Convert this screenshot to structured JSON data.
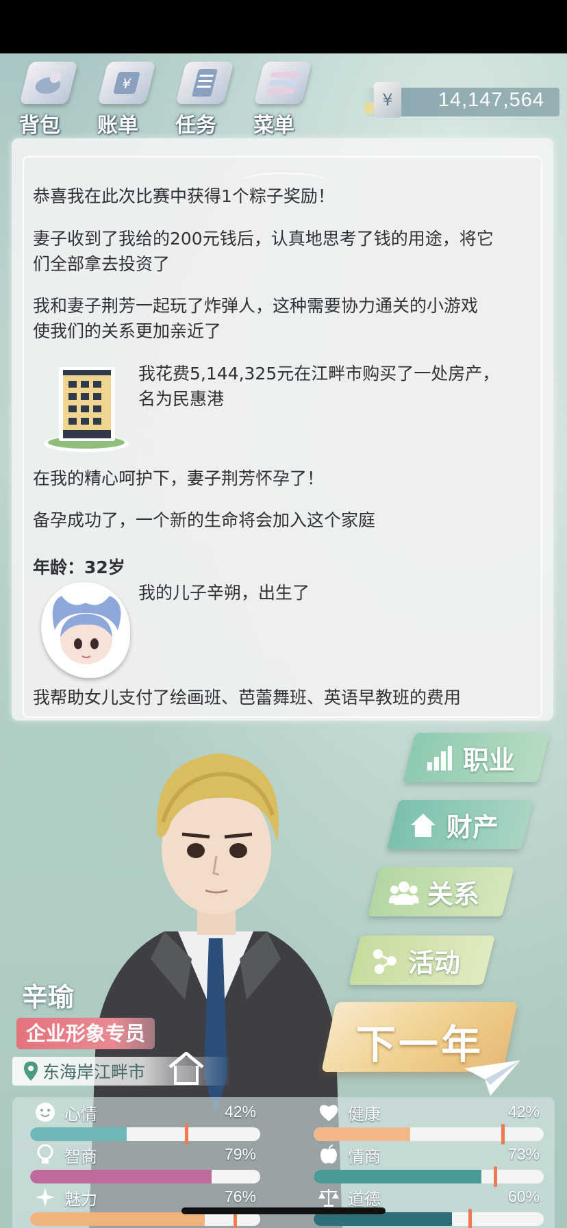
{
  "nav": {
    "bag": "背包",
    "bill": "账单",
    "task": "任务",
    "menu": "菜单"
  },
  "money": {
    "symbol": "¥",
    "amount": "14,147,564"
  },
  "log": {
    "line1": "恭喜我在此次比赛中获得1个粽子奖励！",
    "line2a": "妻子收到了我给的200元钱后，认真地思考了钱的用途，将它",
    "line2b": "们全部拿去投资了",
    "line3a": "我和妻子荆芳一起玩了炸弹人，这种需要协力通关的小游戏",
    "line3b": "使我们的关系更加亲近了",
    "line4a": "我花费5,144,325元在江畔市购买了一处房产，",
    "line4b": "名为民惠港",
    "line5": "在我的精心呵护下，妻子荆芳怀孕了！",
    "line6": "备孕成功了，一个新的生命将会加入这个家庭",
    "age_heading": "年龄：32岁",
    "line7": "我的儿子辛朔，出生了",
    "line8": "我帮助女儿支付了绘画班、芭蕾舞班、英语早教班的费用"
  },
  "menu_buttons": {
    "career": "职业",
    "property": "财产",
    "relation": "关系",
    "activity": "活动",
    "next_year": "下一年"
  },
  "player": {
    "name": "辛瑜",
    "job": "企业形象专员",
    "location": "东海岸江畔市"
  },
  "stats": {
    "mood": {
      "label": "心情",
      "value": "42%",
      "fill": 0.42,
      "color": "#6fb8b8",
      "marker": 0.68
    },
    "health": {
      "label": "健康",
      "value": "42%",
      "fill": 0.42,
      "color": "#f2b889",
      "marker": 0.82
    },
    "iq": {
      "label": "智商",
      "value": "79%",
      "fill": 0.79,
      "color": "#c06a9c",
      "marker": null
    },
    "eq": {
      "label": "情商",
      "value": "73%",
      "fill": 0.73,
      "color": "#4a9a96",
      "marker": 0.79
    },
    "charm": {
      "label": "魅力",
      "value": "76%",
      "fill": 0.76,
      "color": "#f1b37c",
      "marker": 0.89
    },
    "moral": {
      "label": "道德",
      "value": "60%",
      "fill": 0.6,
      "color": "#2f6f78",
      "marker": 0.68
    }
  },
  "icons": {
    "bag": "bag-icon",
    "bill": "bill-icon",
    "task": "task-icon",
    "menu": "menu-icon",
    "coin": "yen-icon"
  }
}
